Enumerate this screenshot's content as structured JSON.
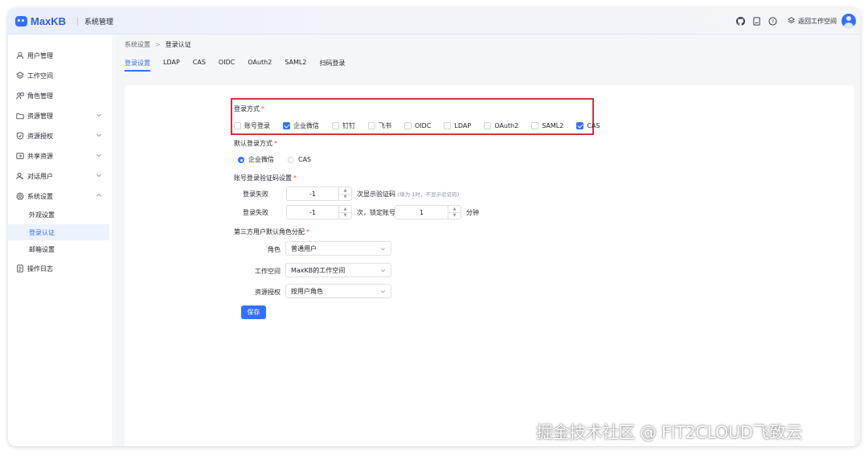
{
  "header": {
    "logo_text": "MaxKB",
    "app_title": "系统管理",
    "back_label": "返回工作空间",
    "icons": [
      "github-icon",
      "document-icon",
      "help-icon",
      "layers-icon"
    ]
  },
  "sidebar": {
    "items": [
      {
        "label": "用户管理",
        "icon": "user-icon"
      },
      {
        "label": "工作空间",
        "icon": "layers-icon"
      },
      {
        "label": "角色管理",
        "icon": "role-icon"
      },
      {
        "label": "资源管理",
        "icon": "folder-icon"
      },
      {
        "label": "资源授权",
        "icon": "shield-icon"
      },
      {
        "label": "共享资源",
        "icon": "share-icon"
      },
      {
        "label": "对话用户",
        "icon": "chat-user-icon"
      },
      {
        "label": "系统设置",
        "icon": "gear-icon"
      },
      {
        "label": "操作日志",
        "icon": "log-icon"
      }
    ],
    "sub_items": [
      {
        "label": "外观设置"
      },
      {
        "label": "登录认证"
      },
      {
        "label": "邮箱设置"
      }
    ]
  },
  "breadcrumb": {
    "parent": "系统设置",
    "current": "登录认证"
  },
  "tabs": [
    {
      "label": "登录设置",
      "active": true
    },
    {
      "label": "LDAP"
    },
    {
      "label": "CAS"
    },
    {
      "label": "OIDC"
    },
    {
      "label": "OAuth2"
    },
    {
      "label": "SAML2"
    },
    {
      "label": "扫码登录"
    }
  ],
  "form": {
    "login_methods": {
      "label": "登录方式",
      "required": "*",
      "options": [
        {
          "label": "账号登录",
          "checked": false
        },
        {
          "label": "企业微信",
          "checked": true
        },
        {
          "label": "钉钉",
          "checked": false
        },
        {
          "label": "飞书",
          "checked": false
        },
        {
          "label": "OIDC",
          "checked": false
        },
        {
          "label": "LDAP",
          "checked": false
        },
        {
          "label": "OAuth2",
          "checked": false
        },
        {
          "label": "SAML2",
          "checked": false
        },
        {
          "label": "CAS",
          "checked": true
        }
      ]
    },
    "default_login": {
      "label": "默认登录方式",
      "required": "*",
      "options": [
        {
          "label": "企业微信",
          "selected": true
        },
        {
          "label": "CAS",
          "selected": false
        }
      ]
    },
    "captcha": {
      "label": "账号登录验证码设置",
      "required": "*",
      "row1": {
        "label": "登录失败",
        "value": "-1",
        "suffix": "次显示验证码",
        "hint": "(填为-1时，不显示验证码)"
      },
      "row2": {
        "label": "登录失败",
        "value": "-1",
        "suffix": "次，锁定账号",
        "value2": "1",
        "suffix2": "分钟"
      }
    },
    "third_party": {
      "label": "第三方用户默认角色分配",
      "required": "*",
      "role": {
        "label": "角色",
        "value": "普通用户"
      },
      "workspace": {
        "label": "工作空间",
        "value": "MaxKB的工作空间"
      },
      "resource": {
        "label": "资源授权",
        "value": "按用户角色"
      }
    },
    "save_label": "保存"
  },
  "watermark": "掘金技术社区 @ FIT2CLOUD飞致云",
  "colors": {
    "accent": "#3370ff",
    "highlight_border": "#d9313a",
    "required": "#f54a45"
  }
}
